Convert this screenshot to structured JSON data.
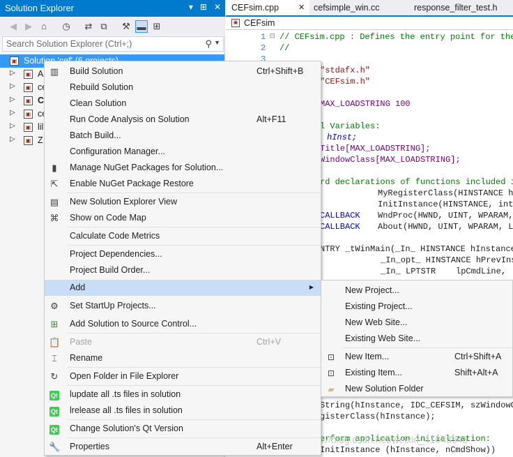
{
  "solution_explorer": {
    "title": "Solution Explorer",
    "title_buttons": [
      "▾",
      "⊞",
      "✕"
    ],
    "search_placeholder": "Search Solution Explorer (Ctrl+;)",
    "tree": [
      {
        "label": "Solution 'cef' (6 projects)",
        "selected": true
      },
      {
        "label": "A"
      },
      {
        "label": "ce"
      },
      {
        "label": "C"
      },
      {
        "label": "ce"
      },
      {
        "label": "lil"
      },
      {
        "label": "Z"
      }
    ]
  },
  "editor": {
    "tabs": [
      {
        "label": "CEFsim.cpp",
        "active": true
      },
      {
        "label": "✕"
      },
      {
        "label": "cefsimple_win.cc"
      },
      {
        "label": "response_filter_test.h"
      }
    ],
    "nav_label": "CEFsim",
    "line_numbers": [
      "1",
      "2",
      "3"
    ],
    "code": {
      "l1": "// CEFsim.cpp : Defines the entry point for the",
      "l2": "//",
      "l4": "\"stdafx.h\"",
      "l5": "\"CEFsim.h\"",
      "l7": "MAX_LOADSTRING 100",
      "l9": "l Variables:",
      "l10": "hInst;",
      "l11": "Title[MAX_LOADSTRING];",
      "l12": "WindowClass[MAX_LOADSTRING];",
      "l14": "rd declarations of functions included in",
      "l15": "MyRegisterClass(HINSTANCE hI",
      "l16": "InitInstance(HINSTANCE, int)",
      "l17a": "CALLBACK",
      "l17b": "WndProc(HWND, UINT, WPARAM,",
      "l18a": "CALLBACK",
      "l18b": "About(HWND, UINT, WPARAM, LP",
      "l20": "NTRY _tWinMain(_In_ HINSTANCE hInstance,",
      "l21": "_In_opt_ HINSTANCE hPrevIns",
      "l22": "_In_ LPTSTR    lpCmdLine,",
      "l_b1": "String(hInstance, IDC_CEFSIM, szWindowCl",
      "l_b2": "gisterClass(hInstance);",
      "l_b3": "erform application initialization:",
      "l_b4": "InitInstance (hInstance, nCmdShow))"
    },
    "watermark": "http://blog.csdn.net/weixin_41043543"
  },
  "context_menu": {
    "items": [
      {
        "icon": "build-icon",
        "glyph": "▥",
        "label": "Build Solution",
        "shortcut": "Ctrl+Shift+B"
      },
      {
        "label": "Rebuild Solution"
      },
      {
        "label": "Clean Solution"
      },
      {
        "label": "Run Code Analysis on Solution",
        "shortcut": "Alt+F11"
      },
      {
        "label": "Batch Build..."
      },
      {
        "label": "Configuration Manager..."
      },
      {
        "icon": "nuget-icon",
        "glyph": "▮",
        "label": "Manage NuGet Packages for Solution..."
      },
      {
        "icon": "package-restore-icon",
        "glyph": "⇱",
        "label": "Enable NuGet Package Restore"
      },
      {
        "icon": "new-view-icon",
        "glyph": "▤",
        "label": "New Solution Explorer View"
      },
      {
        "icon": "code-map-icon",
        "glyph": "⌘",
        "label": "Show on Code Map"
      },
      {
        "label": "Calculate Code Metrics"
      },
      {
        "label": "Project Dependencies..."
      },
      {
        "label": "Project Build Order..."
      },
      {
        "label": "Add",
        "submenu": true
      },
      {
        "icon": "gear-icon",
        "glyph": "⚙",
        "label": "Set StartUp Projects..."
      },
      {
        "icon": "source-control-icon",
        "glyph": "⊞",
        "label": "Add Solution to Source Control..."
      },
      {
        "icon": "paste-icon",
        "glyph": "📋",
        "label": "Paste",
        "shortcut": "Ctrl+V",
        "disabled": true
      },
      {
        "icon": "rename-icon",
        "glyph": "⌶",
        "label": "Rename"
      },
      {
        "icon": "open-folder-icon",
        "glyph": "↻",
        "label": "Open Folder in File Explorer"
      },
      {
        "icon": "qt-icon",
        "glyph": "Qt",
        "label": "lupdate all .ts files in solution"
      },
      {
        "icon": "qt-icon",
        "glyph": "Qt",
        "label": "lrelease all .ts files in solution"
      },
      {
        "icon": "qt-icon",
        "glyph": "Qt",
        "label": "Change Solution's Qt Version"
      },
      {
        "icon": "wrench-icon",
        "glyph": "🔧",
        "label": "Properties",
        "shortcut": "Alt+Enter"
      }
    ]
  },
  "add_submenu": {
    "items": [
      {
        "label": "New Project..."
      },
      {
        "label": "Existing Project..."
      },
      {
        "label": "New Web Site..."
      },
      {
        "label": "Existing Web Site..."
      },
      {
        "icon": "new-item-icon",
        "glyph": "⊡",
        "label": "New Item...",
        "shortcut": "Ctrl+Shift+A"
      },
      {
        "icon": "existing-item-icon",
        "glyph": "⊡",
        "label": "Existing Item...",
        "shortcut": "Shift+Alt+A"
      },
      {
        "icon": "new-folder-icon",
        "glyph": "▰",
        "label": "New Solution Folder"
      }
    ]
  },
  "colors": {
    "accent": "#007acc",
    "selection": "#3399ff",
    "menu_highlight": "#c9def5",
    "menu_background": "#f6f6f6"
  }
}
